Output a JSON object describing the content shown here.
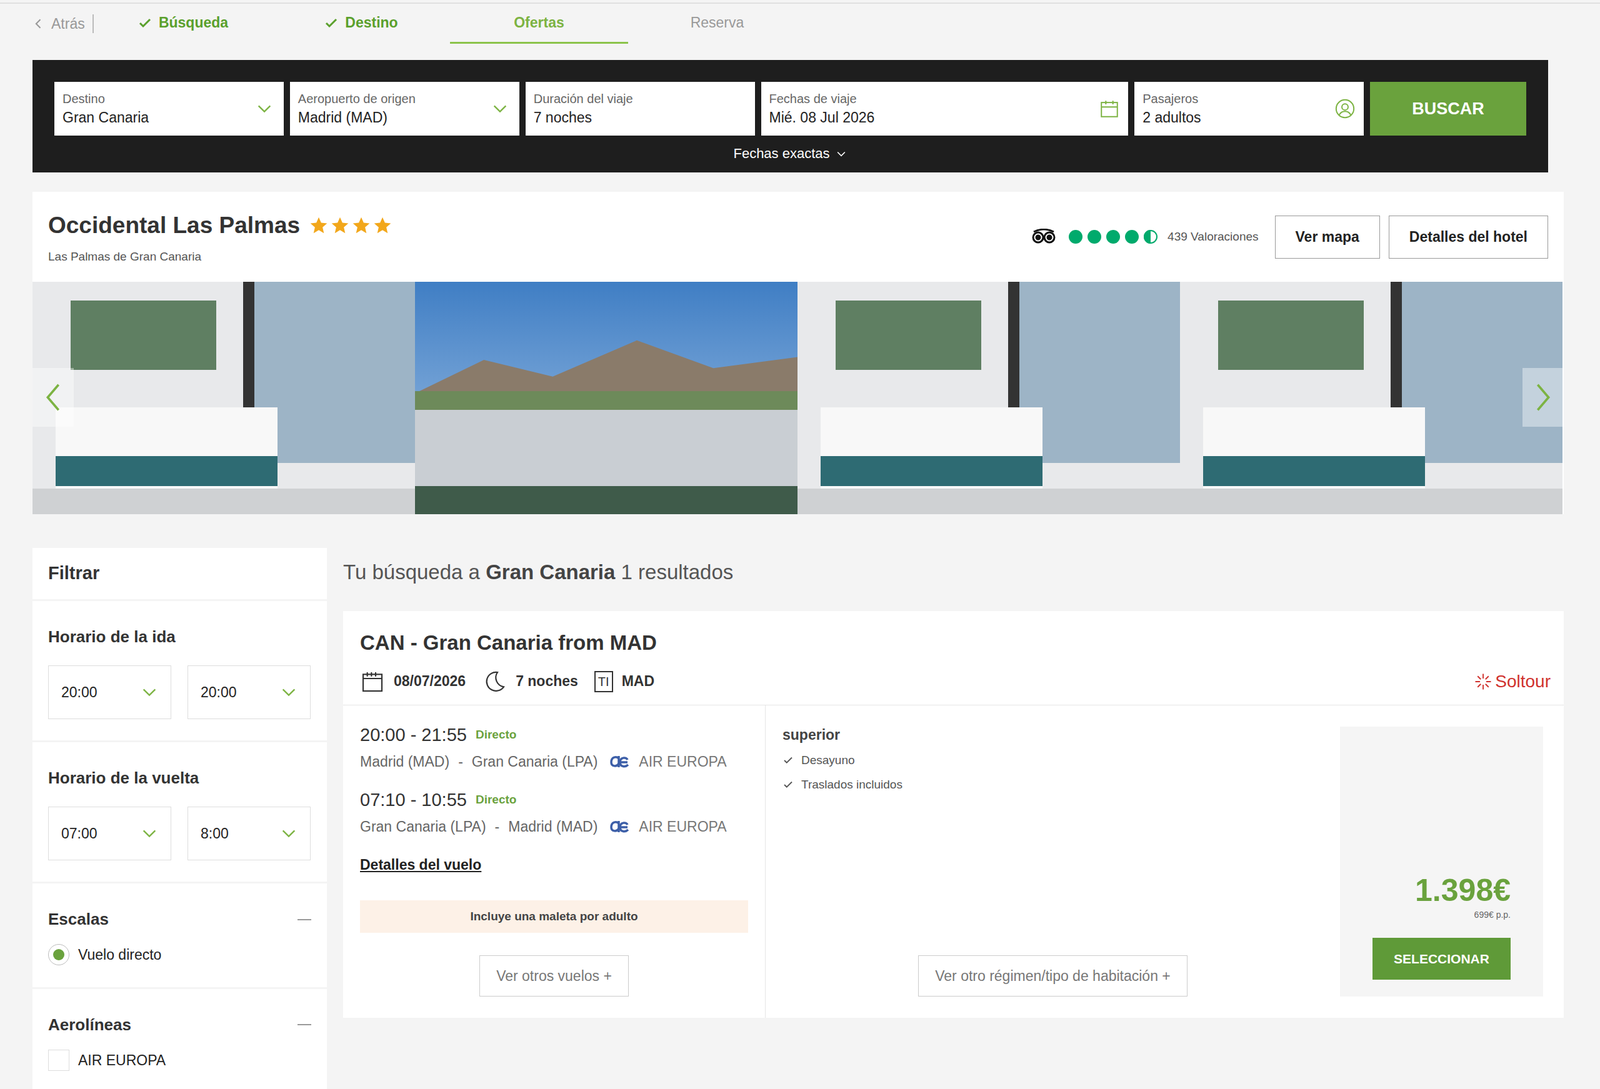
{
  "nav": {
    "back": "Atrás",
    "steps": [
      {
        "label": "Búsqueda",
        "done": true,
        "selected": false
      },
      {
        "label": "Destino",
        "done": true,
        "selected": false
      },
      {
        "label": "Ofertas",
        "done": false,
        "selected": true
      },
      {
        "label": "Reserva",
        "done": false,
        "selected": false
      }
    ]
  },
  "search": {
    "fields": [
      {
        "label": "Destino",
        "value": "Gran Canaria",
        "kind": "select"
      },
      {
        "label": "Aeropuerto de origen",
        "value": "Madrid (MAD)",
        "kind": "select"
      },
      {
        "label": "Duración del viaje",
        "value": "7 noches",
        "kind": "text"
      },
      {
        "label": "Fechas de viaje",
        "value": "Mié. 08 Jul 2026",
        "kind": "date"
      },
      {
        "label": "Pasajeros",
        "value": "2 adultos",
        "kind": "people"
      }
    ],
    "button": "BUSCAR",
    "exact_dates": "Fechas exactas"
  },
  "hotel": {
    "name": "Occidental Las Palmas",
    "stars": 4,
    "location": "Las Palmas de Gran Canaria",
    "rating": 4.5,
    "reviews": "439 Valoraciones",
    "buttons": [
      "Ver mapa",
      "Detalles del hotel"
    ],
    "photos": [
      {
        "kind": "room"
      },
      {
        "kind": "port"
      },
      {
        "kind": "room"
      },
      {
        "kind": "room"
      }
    ]
  },
  "filters": {
    "title": "Filtrar",
    "sections": [
      {
        "title": "Horario de la ida",
        "kind": "time",
        "values": [
          "20:00",
          "20:00"
        ]
      },
      {
        "title": "Horario de la vuelta",
        "kind": "time",
        "values": [
          "07:00",
          "8:00"
        ]
      },
      {
        "title": "Escalas",
        "kind": "radio",
        "expanded": true,
        "options": [
          {
            "label": "Vuelo directo",
            "selected": true
          }
        ]
      },
      {
        "title": "Aerolíneas",
        "kind": "checkbox",
        "expanded": true,
        "options": [
          {
            "label": "AIR EUROPA",
            "checked": false
          }
        ]
      }
    ]
  },
  "results": {
    "prefix": "Tu búsqueda a",
    "destination": "Gran Canaria",
    "count": "1 resultados"
  },
  "offer": {
    "title": "CAN - Gran Canaria from MAD",
    "date": "08/07/2026",
    "nights": "7 noches",
    "terminal": "TI",
    "airport": "MAD",
    "provider": "Soltour",
    "flights": [
      {
        "times": "20:00 - 21:55",
        "badge": "Directo",
        "from": "Madrid (MAD)",
        "separator": "-",
        "to": "Gran Canaria (LPA)",
        "airline": "AIR EUROPA"
      },
      {
        "times": "07:10 - 10:55",
        "badge": "Directo",
        "from": "Gran Canaria (LPA)",
        "separator": "-",
        "to": "Madrid (MAD)",
        "airline": "AIR EUROPA"
      }
    ],
    "details_link": "Detalles del vuelo",
    "luggage": "Incluye una maleta por adulto",
    "more_flights": "Ver otros vuelos +",
    "room": "superior",
    "features": [
      "Desayuno",
      "Traslados incluidos"
    ],
    "more_rooms": "Ver otro régimen/tipo de habitación +",
    "price": "1.398€",
    "price_pp": "699€ p.p.",
    "select": "SELECCIONAR"
  }
}
